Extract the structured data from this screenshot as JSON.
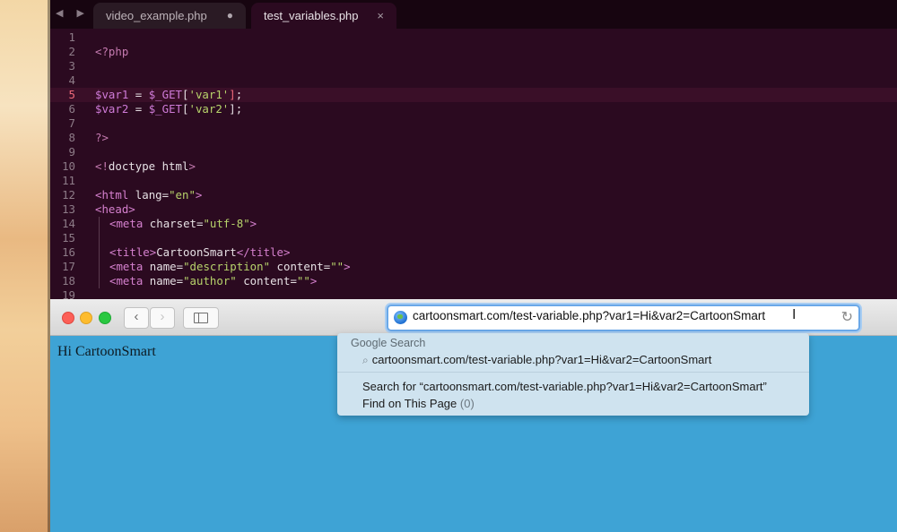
{
  "editor": {
    "tabs": [
      {
        "label": "video_example.php",
        "state": "modified"
      },
      {
        "label": "test_variables.php",
        "state": "active",
        "close": "×"
      }
    ],
    "lines": [
      {
        "n": "1",
        "tokens": []
      },
      {
        "n": "2",
        "tokens": [
          {
            "t": "<?php",
            "c": "php"
          }
        ]
      },
      {
        "n": "3",
        "tokens": []
      },
      {
        "n": "4",
        "tokens": []
      },
      {
        "n": "5",
        "hl": true,
        "tokens": [
          {
            "t": "$var1",
            "c": "var"
          },
          {
            "t": " = ",
            "c": "op"
          },
          {
            "t": "$_GET",
            "c": "var"
          },
          {
            "t": "[",
            "c": "op"
          },
          {
            "t": "'var1'",
            "c": "str"
          },
          {
            "t": "]",
            "c": "red"
          },
          {
            "t": ";",
            "c": "op"
          }
        ]
      },
      {
        "n": "6",
        "tokens": [
          {
            "t": "$var2",
            "c": "var"
          },
          {
            "t": " = ",
            "c": "op"
          },
          {
            "t": "$_GET",
            "c": "var"
          },
          {
            "t": "[",
            "c": "op"
          },
          {
            "t": "'var2'",
            "c": "str"
          },
          {
            "t": "];",
            "c": "op"
          }
        ]
      },
      {
        "n": "7",
        "tokens": []
      },
      {
        "n": "8",
        "tokens": [
          {
            "t": "?>",
            "c": "php"
          }
        ]
      },
      {
        "n": "9",
        "tokens": []
      },
      {
        "n": "10",
        "tokens": [
          {
            "t": "<!",
            "c": "php"
          },
          {
            "t": "doctype html",
            "c": "attr"
          },
          {
            "t": ">",
            "c": "php"
          }
        ]
      },
      {
        "n": "11",
        "tokens": []
      },
      {
        "n": "12",
        "tokens": [
          {
            "t": "<html",
            "c": "tag"
          },
          {
            "t": " lang=",
            "c": "attr"
          },
          {
            "t": "\"en\"",
            "c": "str"
          },
          {
            "t": ">",
            "c": "tag"
          }
        ]
      },
      {
        "n": "13",
        "tokens": [
          {
            "t": "<head>",
            "c": "tag"
          }
        ]
      },
      {
        "n": "14",
        "indent": true,
        "tokens": [
          {
            "t": "<meta",
            "c": "tag"
          },
          {
            "t": " charset=",
            "c": "attr"
          },
          {
            "t": "\"utf-8\"",
            "c": "str"
          },
          {
            "t": ">",
            "c": "tag"
          }
        ]
      },
      {
        "n": "15",
        "indent": true,
        "tokens": []
      },
      {
        "n": "16",
        "indent": true,
        "tokens": [
          {
            "t": "<title>",
            "c": "tag"
          },
          {
            "t": "CartoonSmart",
            "c": "attr"
          },
          {
            "t": "</title>",
            "c": "tag"
          }
        ]
      },
      {
        "n": "17",
        "indent": true,
        "tokens": [
          {
            "t": "<meta",
            "c": "tag"
          },
          {
            "t": " name=",
            "c": "attr"
          },
          {
            "t": "\"description\"",
            "c": "str"
          },
          {
            "t": " content=",
            "c": "attr"
          },
          {
            "t": "\"\"",
            "c": "str"
          },
          {
            "t": ">",
            "c": "tag"
          }
        ]
      },
      {
        "n": "18",
        "indent": true,
        "tokens": [
          {
            "t": "<meta",
            "c": "tag"
          },
          {
            "t": " name=",
            "c": "attr"
          },
          {
            "t": "\"author\"",
            "c": "str"
          },
          {
            "t": " content=",
            "c": "attr"
          },
          {
            "t": "\"\"",
            "c": "str"
          },
          {
            "t": ">",
            "c": "tag"
          }
        ]
      },
      {
        "n": "19",
        "tokens": []
      }
    ]
  },
  "browser": {
    "url": "cartoonsmart.com/test-variable.php?var1=Hi&var2=CartoonSmart",
    "page_text": "Hi CartoonSmart",
    "dropdown": {
      "header": "Google Search",
      "suggestion": "cartoonsmart.com/test-variable.php?var1=Hi&var2=CartoonSmart",
      "search_for": "Search for “cartoonsmart.com/test-variable.php?var1=Hi&var2=CartoonSmart”",
      "find_on_page": "Find on This Page",
      "find_count": "(0)"
    }
  },
  "colors": {
    "editor_bg": "#2b0a20",
    "page_bg": "#3ea3d5",
    "dropdown_bg": "#cfe3ef"
  },
  "icons": [
    "back-arrow-icon",
    "forward-arrow-icon",
    "sidebar-icon",
    "globe-icon",
    "reload-icon",
    "search-icon",
    "close-icon"
  ]
}
